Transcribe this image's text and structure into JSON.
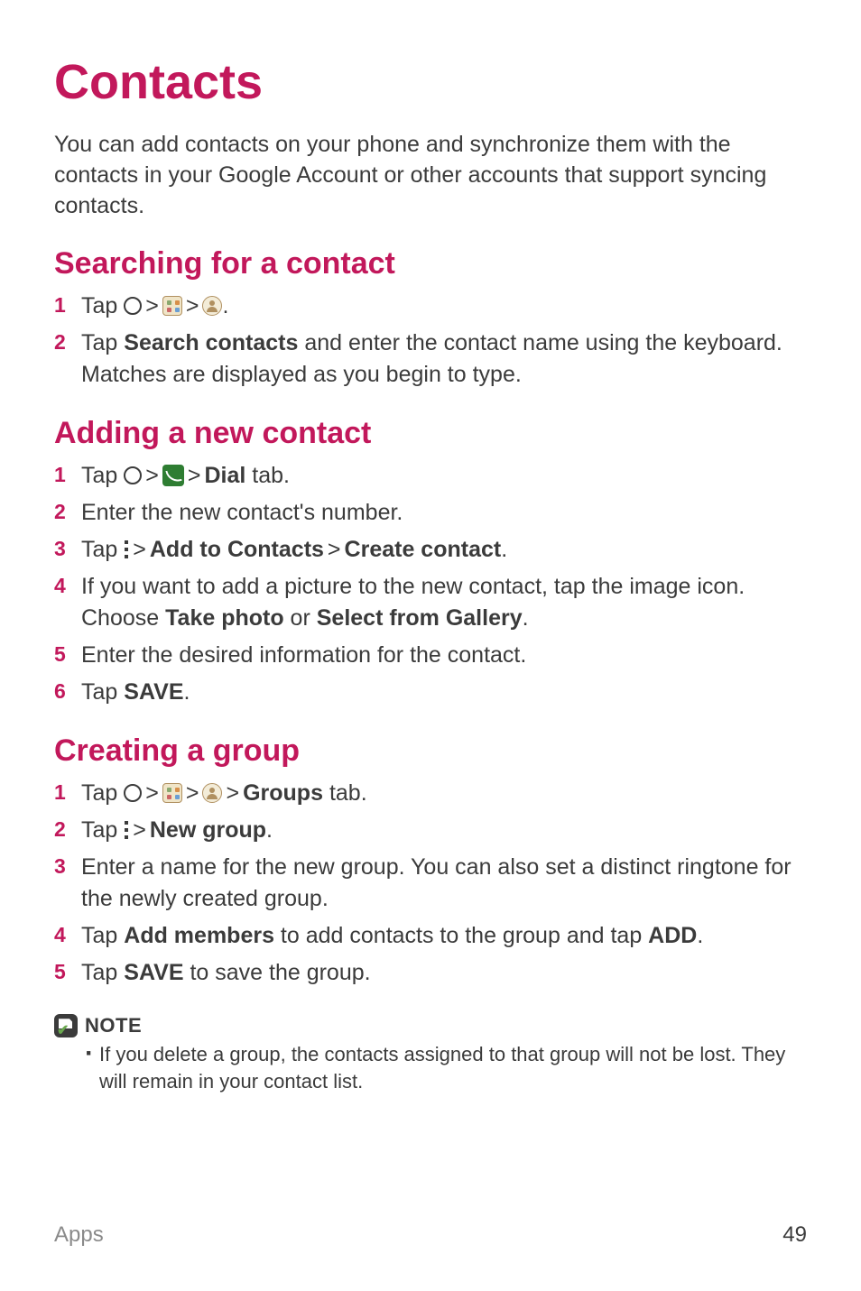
{
  "title": "Contacts",
  "intro": "You can add contacts on your phone and synchronize them with the contacts in your Google Account or other accounts that support syncing contacts.",
  "sec1": {
    "heading": "Searching for a contact",
    "s1_a": "Tap ",
    "s1_b": ".",
    "s2_a": "Tap ",
    "s2_bold": "Search contacts",
    "s2_b": " and enter the contact name using the keyboard. Matches are displayed as you begin to type."
  },
  "sec2": {
    "heading": "Adding a new contact",
    "s1_a": "Tap ",
    "s1_bold": "Dial",
    "s1_b": " tab.",
    "s2": "Enter the new contact's number.",
    "s3_a": "Tap ",
    "s3_bold1": "Add to Contacts",
    "s3_bold2": "Create contact",
    "s3_end": ".",
    "s4_a": "If you want to add a picture to the new contact, tap the image icon. Choose ",
    "s4_bold1": "Take photo",
    "s4_or": " or ",
    "s4_bold2": "Select from Gallery",
    "s4_end": ".",
    "s5": "Enter the desired information for the contact.",
    "s6_a": "Tap ",
    "s6_bold": "SAVE",
    "s6_end": "."
  },
  "sec3": {
    "heading": "Creating a group",
    "s1_a": "Tap ",
    "s1_bold": "Groups",
    "s1_b": " tab.",
    "s2_a": "Tap ",
    "s2_bold": "New group",
    "s2_end": ".",
    "s3": "Enter a name for the new group. You can also set a distinct ringtone for the newly created group.",
    "s4_a": "Tap ",
    "s4_bold1": "Add members",
    "s4_b": " to add contacts to the group and tap ",
    "s4_bold2": "ADD",
    "s4_end": ".",
    "s5_a": "Tap ",
    "s5_bold": "SAVE",
    "s5_b": " to save the group."
  },
  "note": {
    "label": "NOTE",
    "item": "If you delete a group, the contacts assigned to that group will not be lost. They will remain in your contact list."
  },
  "footer": {
    "section": "Apps",
    "page": "49"
  },
  "gt": ">"
}
